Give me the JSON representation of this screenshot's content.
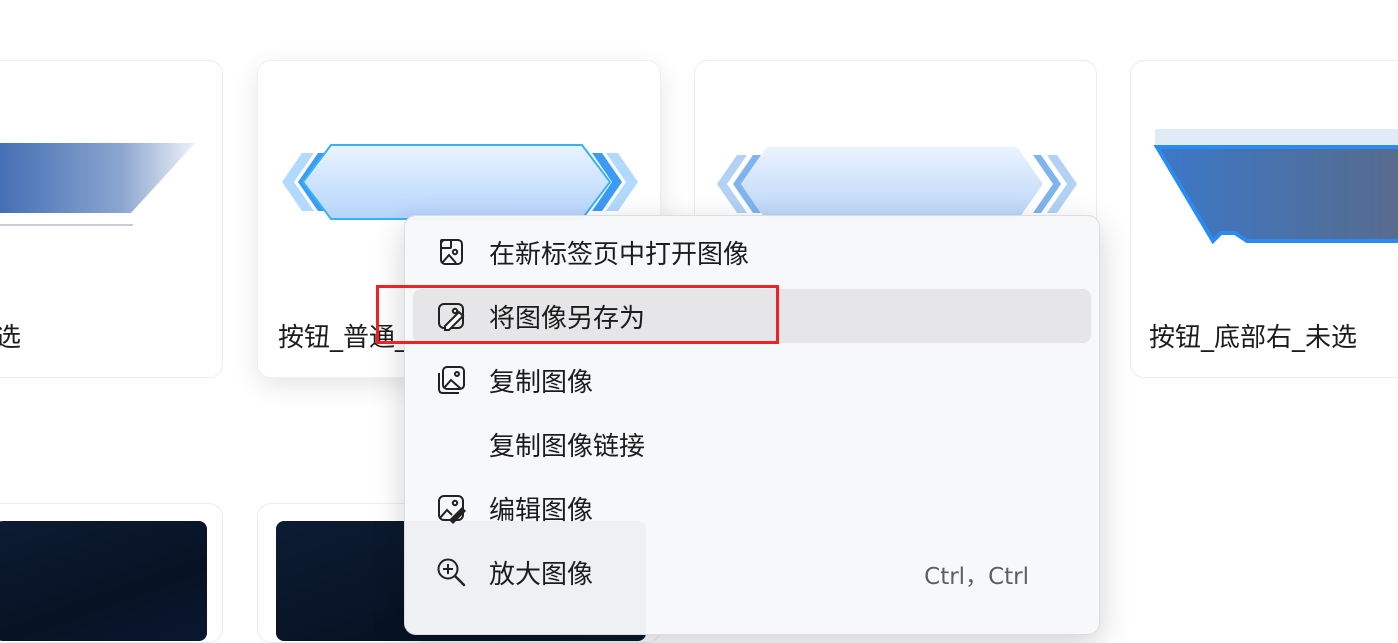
{
  "cards": [
    {
      "title": "未选"
    },
    {
      "title": "按钮_普通_"
    },
    {
      "title": ""
    },
    {
      "title": "按钮_底部右_未选"
    }
  ],
  "context_menu": {
    "items": [
      {
        "label": "在新标签页中打开图像",
        "icon": "open-in-new-tab-icon"
      },
      {
        "label": "将图像另存为",
        "icon": "save-image-icon",
        "active": true
      },
      {
        "label": "复制图像",
        "icon": "copy-image-icon"
      },
      {
        "label": "复制图像链接",
        "icon": ""
      },
      {
        "label": "编辑图像",
        "icon": "edit-image-icon"
      },
      {
        "label": "放大图像",
        "icon": "zoom-in-icon",
        "shortcut": "Ctrl，Ctrl"
      }
    ]
  },
  "colors": {
    "highlight_box": "#ee2222",
    "menu_active_bg": "#e6e6e8",
    "button_blue": "#2a8cf0",
    "thumb_dark": "#0a1730"
  }
}
